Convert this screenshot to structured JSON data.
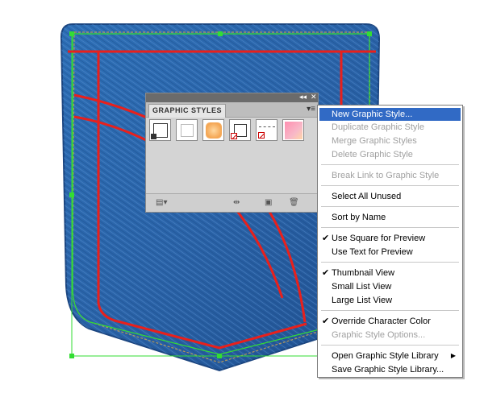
{
  "colors": {
    "denim": "#2b6cb0",
    "stitch": "#e8201c",
    "selection": "#33dd33",
    "menu_highlight": "#316ac5"
  },
  "panel": {
    "title": "GRAPHIC STYLES",
    "collapse_icon": "double-chevron-left-icon",
    "close_icon": "close-icon",
    "menu_icon": "panel-menu-icon",
    "swatches": [
      {
        "name": "default-style"
      },
      {
        "name": "empty-style"
      },
      {
        "name": "orange-glow-style"
      },
      {
        "name": "no-fill-style"
      },
      {
        "name": "dashed-stroke-style"
      },
      {
        "name": "pink-gradient-style"
      }
    ],
    "bottom_icons": [
      "graphic-style-libraries-icon",
      "break-link-icon",
      "new-style-icon",
      "delete-icon"
    ]
  },
  "menu": {
    "items": [
      {
        "label": "New Graphic Style...",
        "state": "highlight"
      },
      {
        "label": "Duplicate Graphic Style",
        "state": "disabled"
      },
      {
        "label": "Merge Graphic Styles",
        "state": "disabled"
      },
      {
        "label": "Delete Graphic Style",
        "state": "disabled"
      },
      {
        "label": "Break Link to Graphic Style",
        "state": "disabled"
      },
      {
        "label": "Select All Unused",
        "state": "normal"
      },
      {
        "label": "Sort by Name",
        "state": "normal"
      },
      {
        "label": "Use Square for Preview",
        "state": "checked"
      },
      {
        "label": "Use Text for Preview",
        "state": "normal"
      },
      {
        "label": "Thumbnail View",
        "state": "checked"
      },
      {
        "label": "Small List View",
        "state": "normal"
      },
      {
        "label": "Large List View",
        "state": "normal"
      },
      {
        "label": "Override Character Color",
        "state": "checked"
      },
      {
        "label": "Graphic Style Options...",
        "state": "disabled"
      },
      {
        "label": "Open Graphic Style Library",
        "state": "submenu"
      },
      {
        "label": "Save Graphic Style Library...",
        "state": "normal"
      }
    ]
  }
}
